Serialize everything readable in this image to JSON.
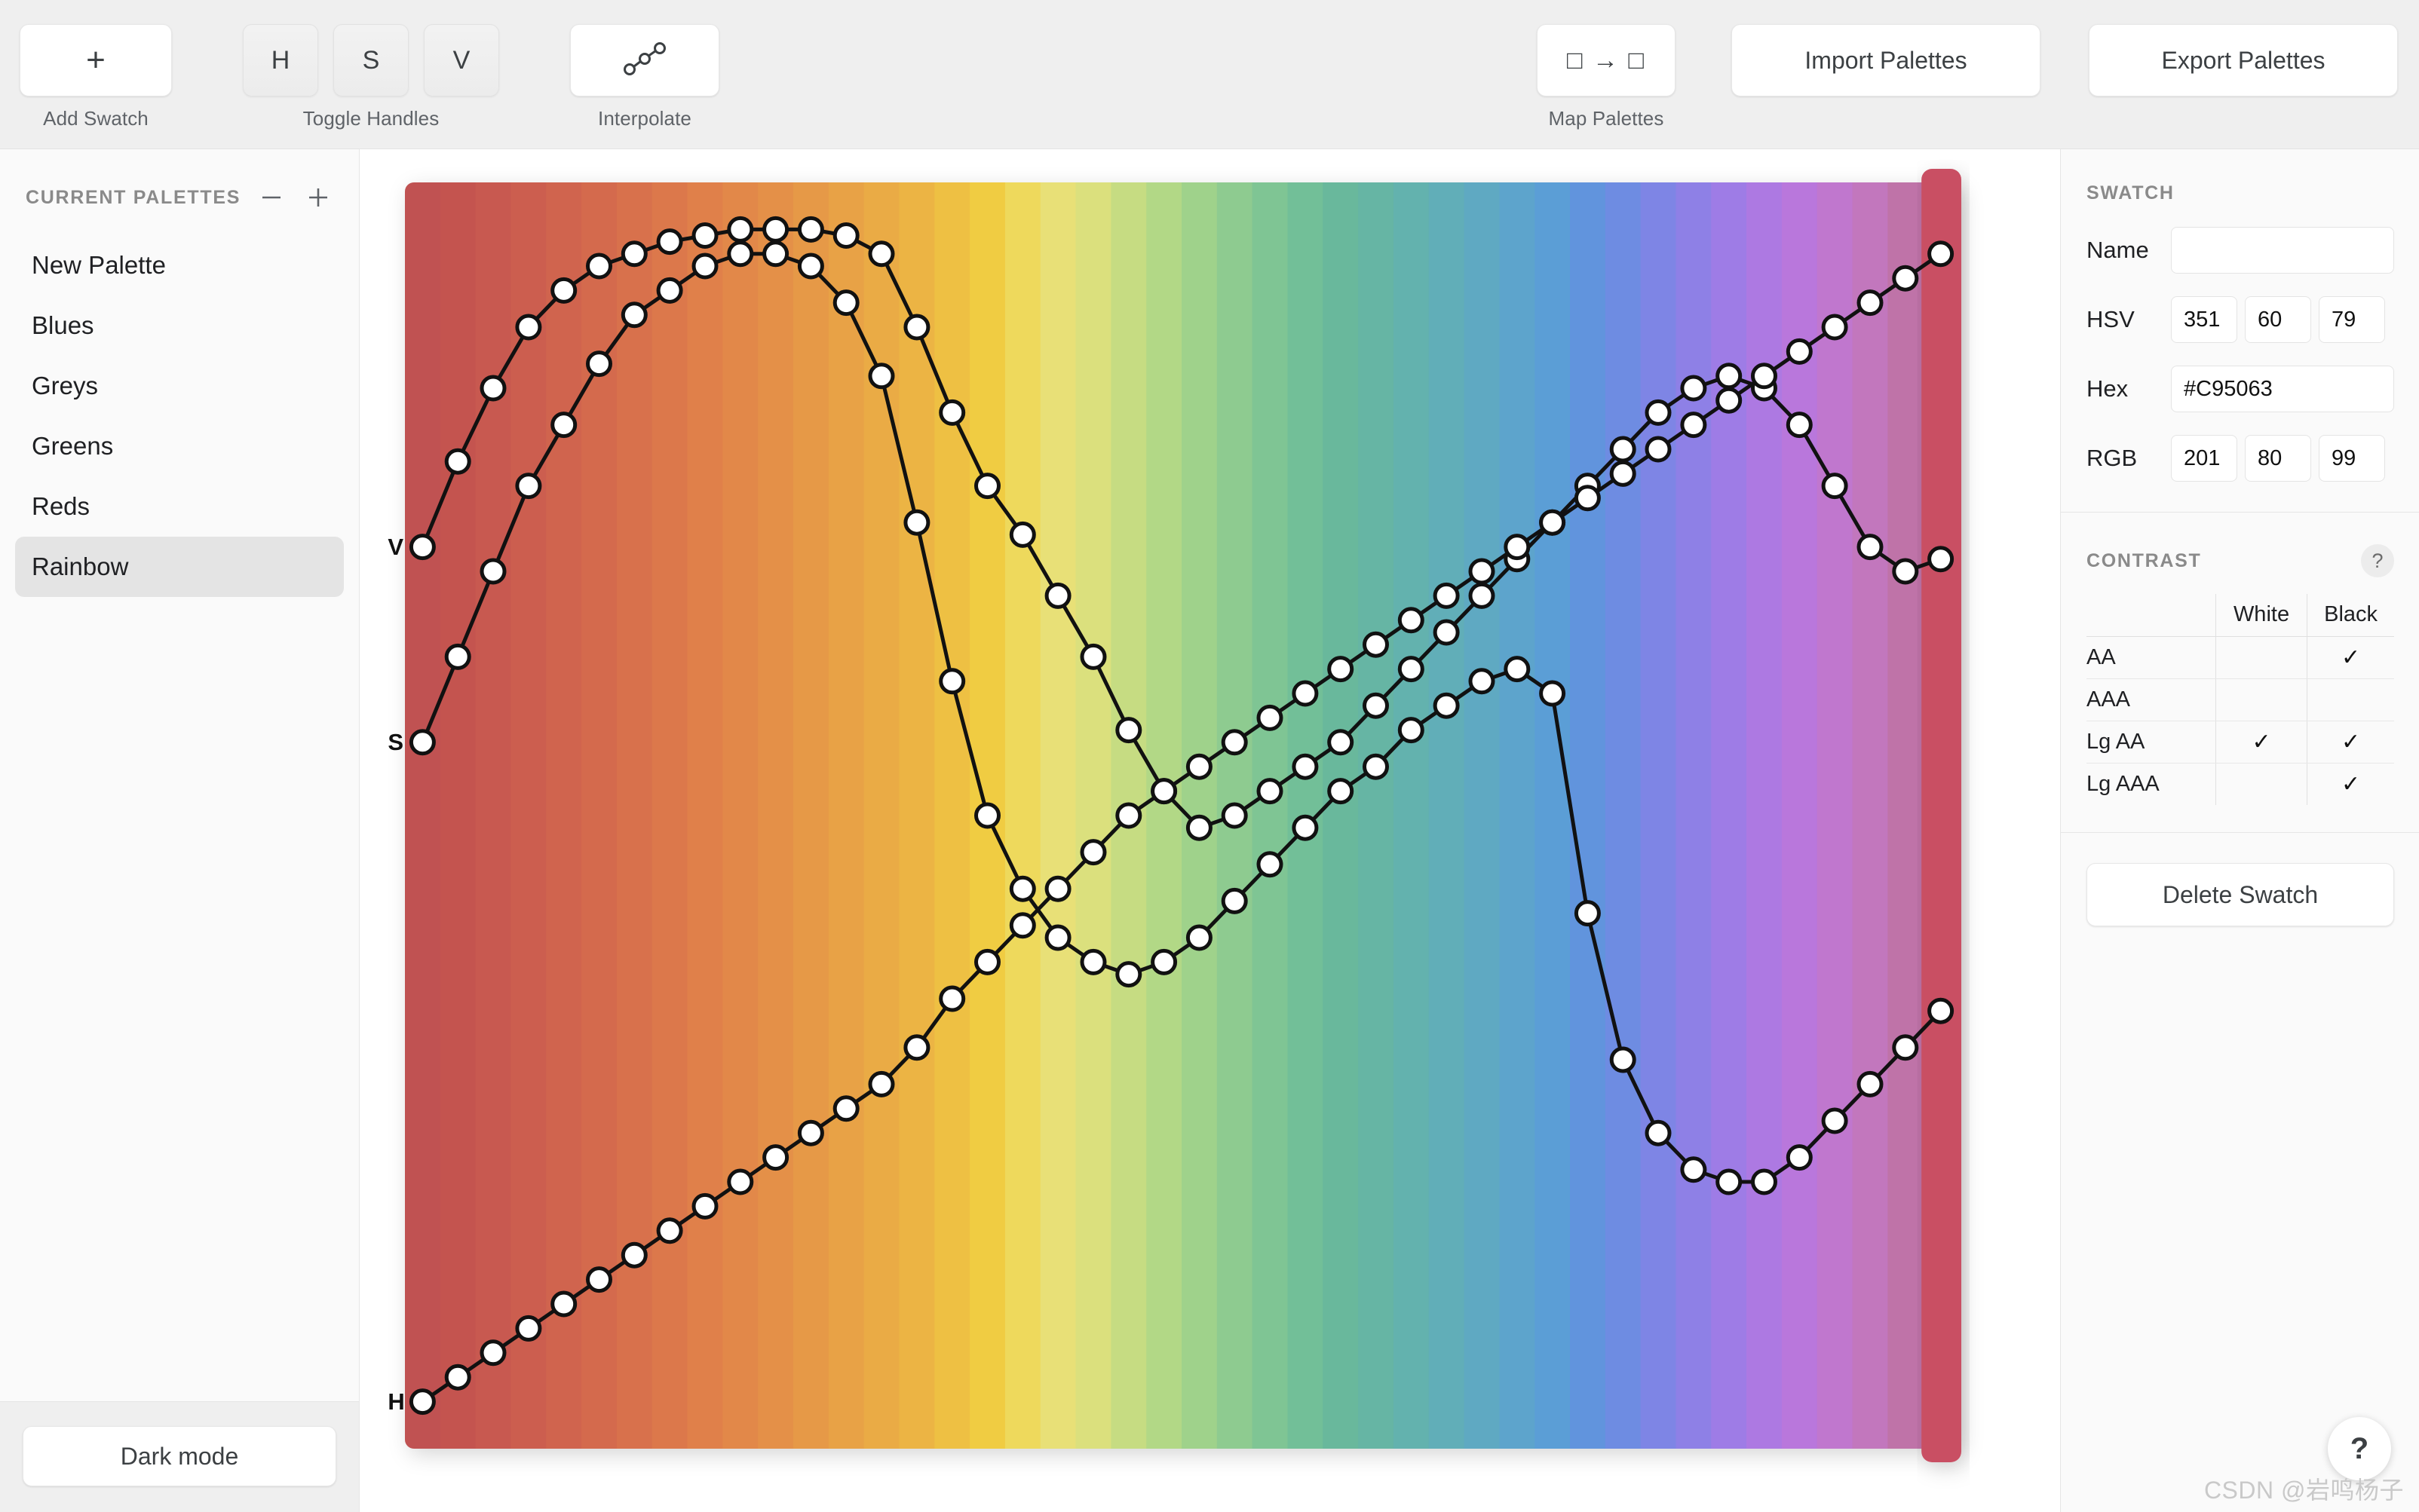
{
  "toolbar": {
    "add_swatch": {
      "label": "Add Swatch",
      "icon": "plus-icon",
      "glyph": "+"
    },
    "toggle_handles": {
      "label": "Toggle Handles",
      "buttons": [
        "H",
        "S",
        "V"
      ]
    },
    "interpolate": {
      "label": "Interpolate",
      "icon": "interpolate-icon"
    },
    "map_palettes": {
      "label": "Map Palettes",
      "icon": "map-arrow-icon",
      "glyph": "□ → □"
    },
    "import_palettes": "Import Palettes",
    "export_palettes": "Export Palettes"
  },
  "sidebar": {
    "title": "CURRENT PALETTES",
    "remove_icon": "minus-icon",
    "add_icon": "plus-icon",
    "items": [
      {
        "label": "New Palette",
        "selected": false
      },
      {
        "label": "Blues",
        "selected": false
      },
      {
        "label": "Greys",
        "selected": false
      },
      {
        "label": "Greens",
        "selected": false
      },
      {
        "label": "Reds",
        "selected": false
      },
      {
        "label": "Rainbow",
        "selected": true
      }
    ],
    "dark_mode": "Dark mode"
  },
  "swatch": {
    "section_title": "SWATCH",
    "name_label": "Name",
    "name_value": "",
    "hsv_label": "HSV",
    "hsv": {
      "h": "351",
      "s": "60",
      "v": "79"
    },
    "hex_label": "Hex",
    "hex": "#C95063",
    "rgb_label": "RGB",
    "rgb": {
      "r": "201",
      "g": "80",
      "b": "99"
    }
  },
  "contrast": {
    "section_title": "CONTRAST",
    "help_glyph": "?",
    "columns": [
      "",
      "White",
      "Black"
    ],
    "rows": [
      {
        "label": "AA",
        "white": "",
        "black": "✓"
      },
      {
        "label": "AAA",
        "white": "",
        "black": ""
      },
      {
        "label": "Lg AA",
        "white": "✓",
        "black": "✓"
      },
      {
        "label": "Lg AAA",
        "white": "",
        "black": "✓"
      }
    ]
  },
  "actions": {
    "delete_swatch": "Delete Swatch",
    "help_fab": "?"
  },
  "watermark": "CSDN @岩鸣杨子",
  "chart_data": {
    "type": "line",
    "title": "",
    "xlabel": "",
    "ylabel": "",
    "ylim": [
      0,
      100
    ],
    "grid": false,
    "legend_position": "left-axis-labels",
    "background": "hue-band-gradient",
    "selected_index": 43,
    "selected_color": "#C95063",
    "n_swatches": 44,
    "band_colors": [
      "#c05252",
      "#c4544f",
      "#c85950",
      "#cc5e4f",
      "#d0644e",
      "#d46a4d",
      "#d8714c",
      "#dc784b",
      "#e0804a",
      "#e28849",
      "#e49048",
      "#e69947",
      "#e8a246",
      "#eaab45",
      "#ecb444",
      "#eec043",
      "#f0cc42",
      "#eed95c",
      "#e8e077",
      "#dbe07d",
      "#c6dc82",
      "#b2d886",
      "#9fd28b",
      "#8ecb90",
      "#7fc594",
      "#72bf98",
      "#69b89c",
      "#66b5a4",
      "#63b2ae",
      "#61aeb8",
      "#5fa9c2",
      "#5da4cc",
      "#5b9ed6",
      "#6194dd",
      "#6e8ce2",
      "#7e85e5",
      "#8e80e6",
      "#9e7ce6",
      "#ad79e2",
      "#b977dc",
      "#c077ce",
      "#c277bd",
      "#bf73a8",
      "#c95063"
    ],
    "series": [
      {
        "name": "V",
        "axis_label": "V",
        "color": "#111111",
        "values": [
          72,
          79,
          85,
          90,
          93,
          95,
          96,
          97,
          97.5,
          98,
          98,
          98,
          97.5,
          96,
          90,
          83,
          77,
          73,
          68,
          63,
          57,
          52,
          49,
          50,
          52,
          54,
          56,
          59,
          62,
          65,
          68,
          71,
          74,
          77,
          80,
          83,
          85,
          86,
          85,
          82,
          77,
          72,
          70,
          71
        ]
      },
      {
        "name": "S",
        "axis_label": "S",
        "color": "#111111",
        "values": [
          56,
          63,
          70,
          77,
          82,
          87,
          91,
          93,
          95,
          96,
          96,
          95,
          92,
          86,
          74,
          61,
          50,
          44,
          40,
          38,
          37,
          38,
          40,
          43,
          46,
          49,
          52,
          54,
          57,
          59,
          61,
          62,
          60,
          42,
          30,
          24,
          21,
          20,
          20,
          22,
          25,
          28,
          31,
          34
        ]
      },
      {
        "name": "H",
        "axis_label": "H",
        "color": "#111111",
        "values": [
          2,
          4,
          6,
          8,
          10,
          12,
          14,
          16,
          18,
          20,
          22,
          24,
          26,
          28,
          31,
          35,
          38,
          41,
          44,
          47,
          50,
          52,
          54,
          56,
          58,
          60,
          62,
          64,
          66,
          68,
          70,
          72,
          74,
          76,
          78,
          80,
          82,
          84,
          86,
          88,
          90,
          92,
          94,
          96
        ]
      }
    ]
  }
}
